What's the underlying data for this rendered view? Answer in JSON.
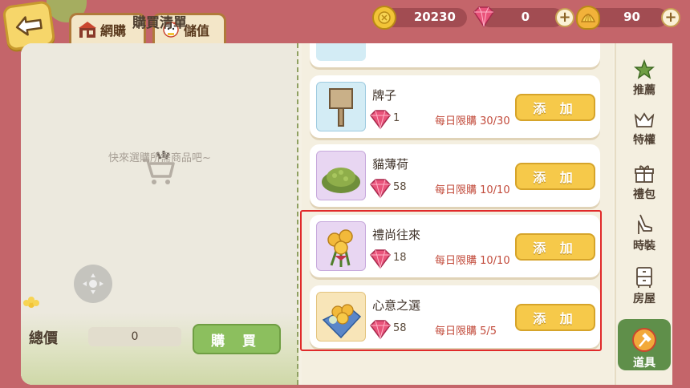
{
  "nav": {
    "back_label": "",
    "tabs": [
      {
        "label": "網購",
        "icon": "shop-icon"
      },
      {
        "label": "儲值",
        "icon": "lucky-cat-icon"
      }
    ]
  },
  "currency": {
    "coins": "20230",
    "gems": "0",
    "shells": "90"
  },
  "cart": {
    "title": "購買清單",
    "empty_text": "快來選購所需商品吧~",
    "total_label": "總價",
    "total_value": "0",
    "buy_label": "購 買"
  },
  "items": [
    {
      "name": "牌子",
      "price": "1",
      "limit": "每日限購 30/30",
      "add_label": "添 加",
      "thumb_bg": "#d3ecf5",
      "icon": "sign-icon"
    },
    {
      "name": "貓薄荷",
      "price": "58",
      "limit": "每日限購 10/10",
      "add_label": "添 加",
      "thumb_bg": "#e8d6f2",
      "icon": "catnip-icon"
    },
    {
      "name": "禮尚往來",
      "price": "18",
      "limit": "每日限購 10/10",
      "add_label": "添 加",
      "thumb_bg": "#e8d6f2",
      "icon": "bouquet-icon"
    },
    {
      "name": "心意之選",
      "price": "58",
      "limit": "每日限購 5/5",
      "add_label": "添 加",
      "thumb_bg": "#f8e5b8",
      "icon": "flower-box-icon"
    }
  ],
  "sidebar": [
    {
      "label": "推薦",
      "icon": "star-icon"
    },
    {
      "label": "特權",
      "icon": "crown-icon"
    },
    {
      "label": "禮包",
      "icon": "gift-icon"
    },
    {
      "label": "時裝",
      "icon": "high-heel-icon"
    },
    {
      "label": "房屋",
      "icon": "cabinet-icon"
    },
    {
      "label": "道具",
      "icon": "shovel-icon",
      "active": true
    }
  ],
  "colors": {
    "background": "#c4656a",
    "accent_yellow": "#f6c94a",
    "accent_green": "#8cbf5e",
    "limit_red": "#c24a3a",
    "highlight": "#e02a2a"
  }
}
